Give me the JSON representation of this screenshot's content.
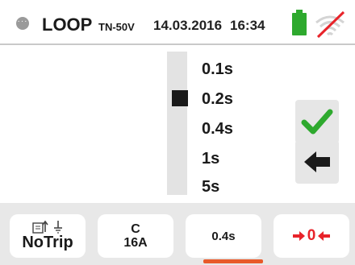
{
  "header": {
    "title": "LOOP",
    "subtitle": "TN-50V",
    "date": "14.03.2016",
    "time": "16:34",
    "menu_icon": "menu-dots-icon",
    "battery_icon": "battery-icon",
    "wifi_icon": "wifi-disabled-icon"
  },
  "selector": {
    "options": [
      "0.1s",
      "0.2s",
      "0.4s",
      "1s",
      "5s"
    ],
    "selected_index": 1
  },
  "side_buttons": {
    "confirm_icon": "check-icon",
    "back_icon": "back-arrow-icon"
  },
  "tabs": {
    "notrip": {
      "label": "NoTrip",
      "icon": "notrip-icon"
    },
    "breaker": {
      "line1": "C",
      "line2": "16A"
    },
    "time": {
      "label": "0.4s"
    },
    "zero": {
      "label": "0",
      "icon": "zero-calibration-icon"
    }
  },
  "colors": {
    "accent": "#e85a2a",
    "check": "#2ea92e",
    "battery": "#2ea92e",
    "zero": "#e8232a",
    "no_signal": "#e8232a"
  }
}
